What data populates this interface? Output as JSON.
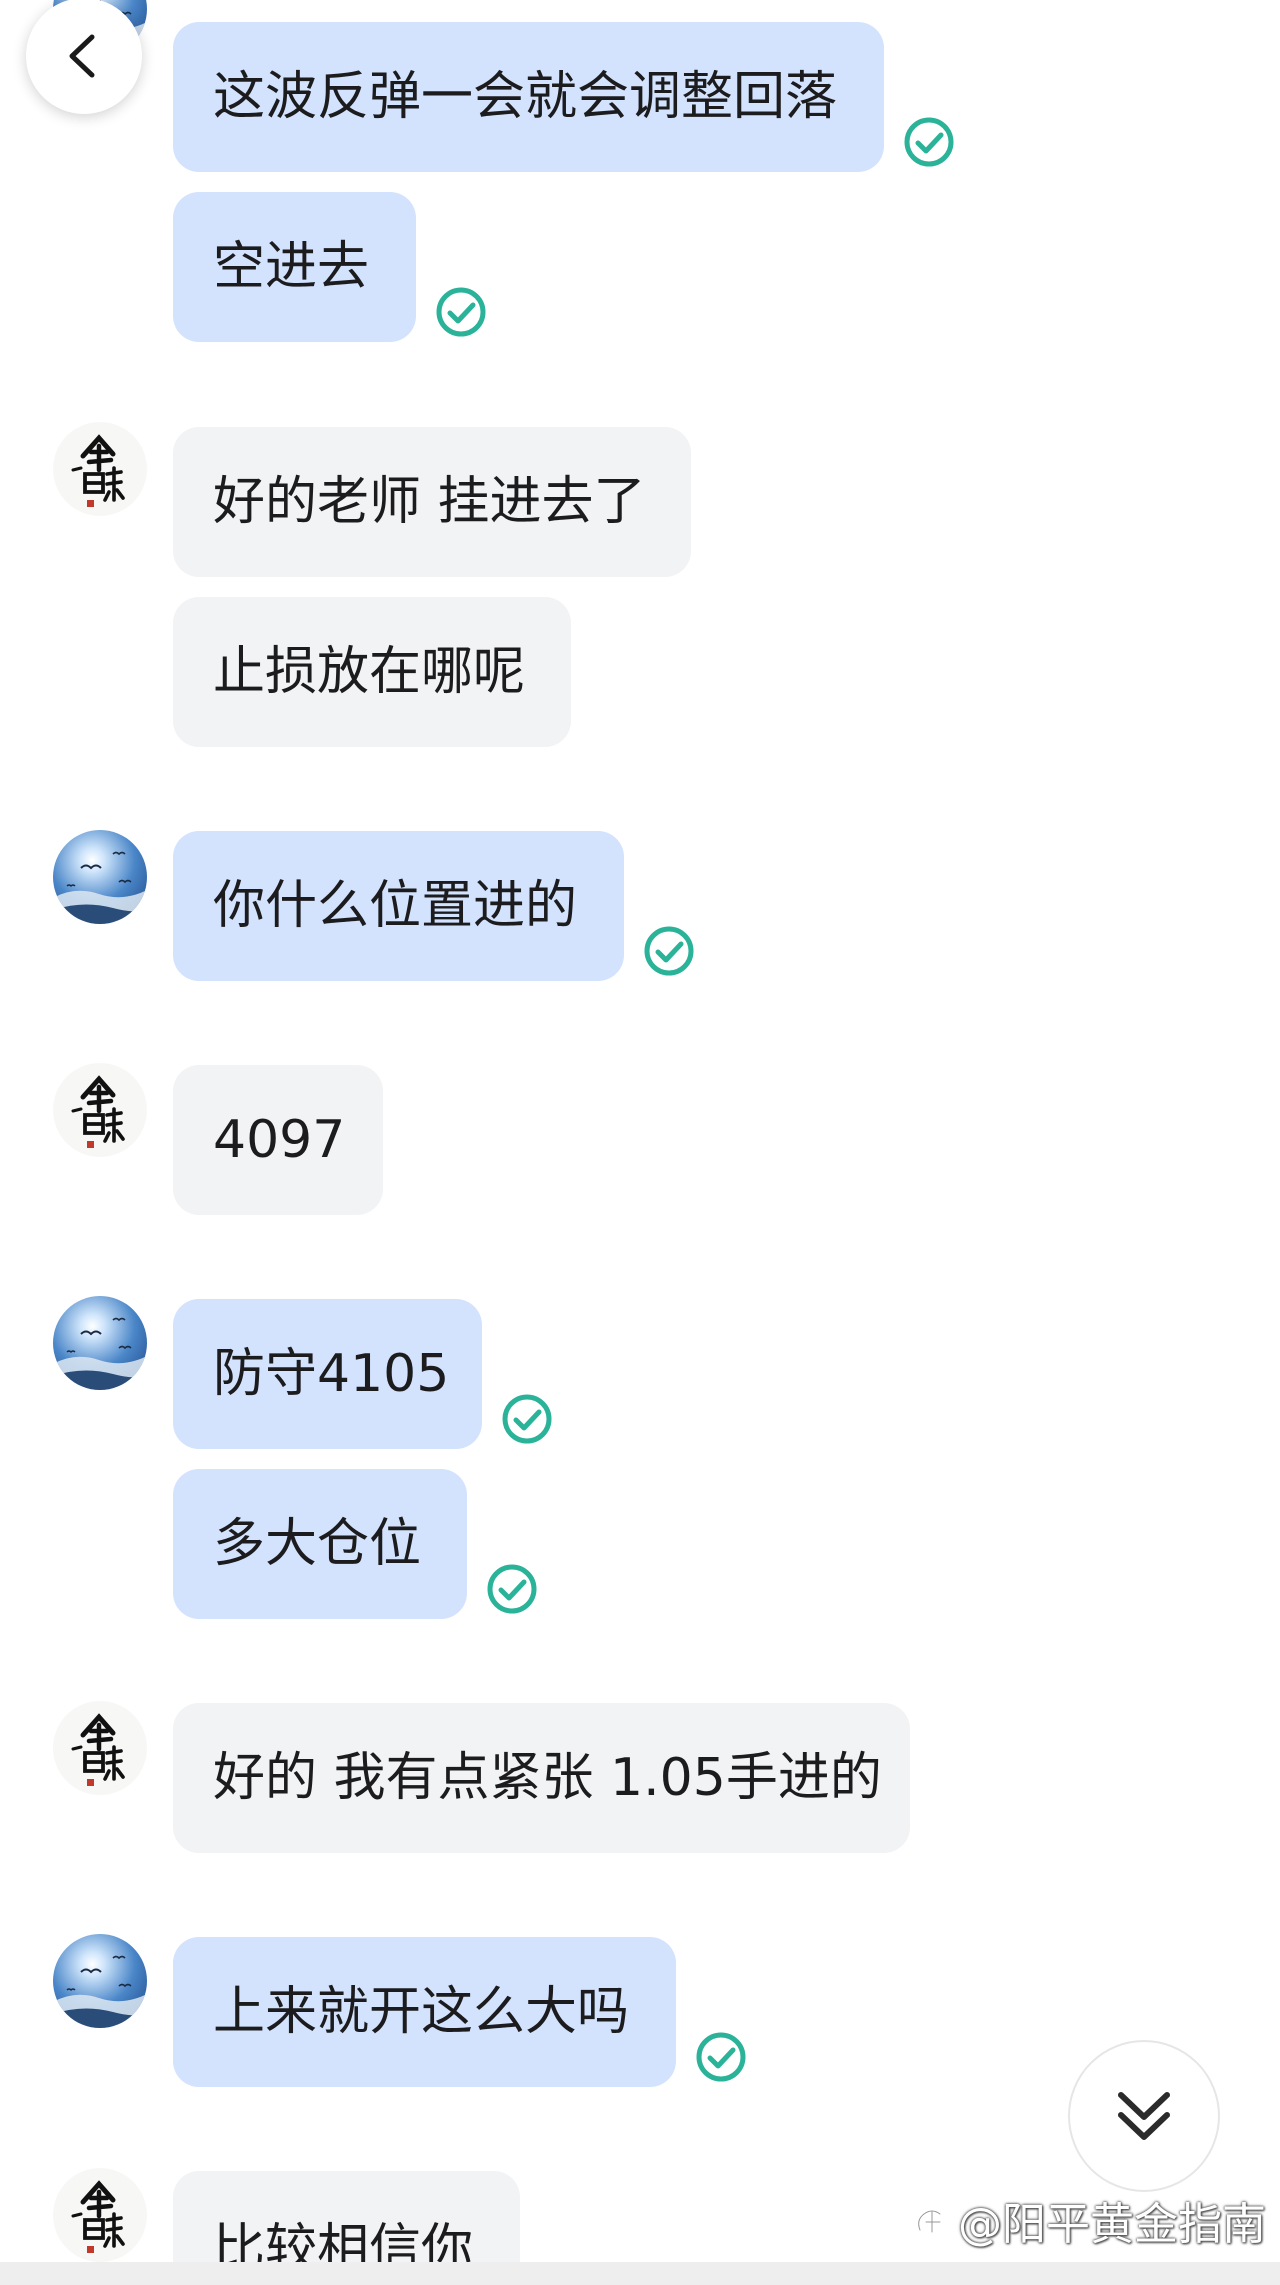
{
  "header": {
    "back_icon": "chevron-left-icon"
  },
  "messages": [
    {
      "sender": "teacher",
      "text": "这波反弹一会就会调整回落",
      "status": "sent-check-icon"
    },
    {
      "sender": "teacher",
      "text": "空进去",
      "status": "sent-check-icon"
    },
    {
      "sender": "student",
      "text": "好的老师 挂进去了"
    },
    {
      "sender": "student",
      "text": "止损放在哪呢"
    },
    {
      "sender": "teacher",
      "text": "你什么位置进的",
      "status": "sent-check-icon"
    },
    {
      "sender": "student",
      "text": "4097"
    },
    {
      "sender": "teacher",
      "text": "防守4105",
      "status": "sent-check-icon"
    },
    {
      "sender": "teacher",
      "text": "多大仓位",
      "status": "sent-check-icon"
    },
    {
      "sender": "student",
      "text": "好的 我有点紧张 1.05手进的"
    },
    {
      "sender": "teacher",
      "text": "上来就开这么大吗",
      "status": "sent-check-icon"
    },
    {
      "sender": "student",
      "text": "比较相信你"
    }
  ],
  "avatars": {
    "teacher": {
      "icon": "sky-birds-avatar"
    },
    "student": {
      "icon": "calligraphy-avatar",
      "logo_text": "人生百味"
    }
  },
  "scroll_button": {
    "icon": "double-chevron-down-icon"
  },
  "watermark": {
    "text": "@阳平黄金指南",
    "icon": "zhihu-logo-icon"
  },
  "colors": {
    "my_bubble": "#d3e3fd",
    "their_bubble": "#f2f3f5",
    "check": "#2bb39a",
    "text": "#1c1c1e"
  }
}
